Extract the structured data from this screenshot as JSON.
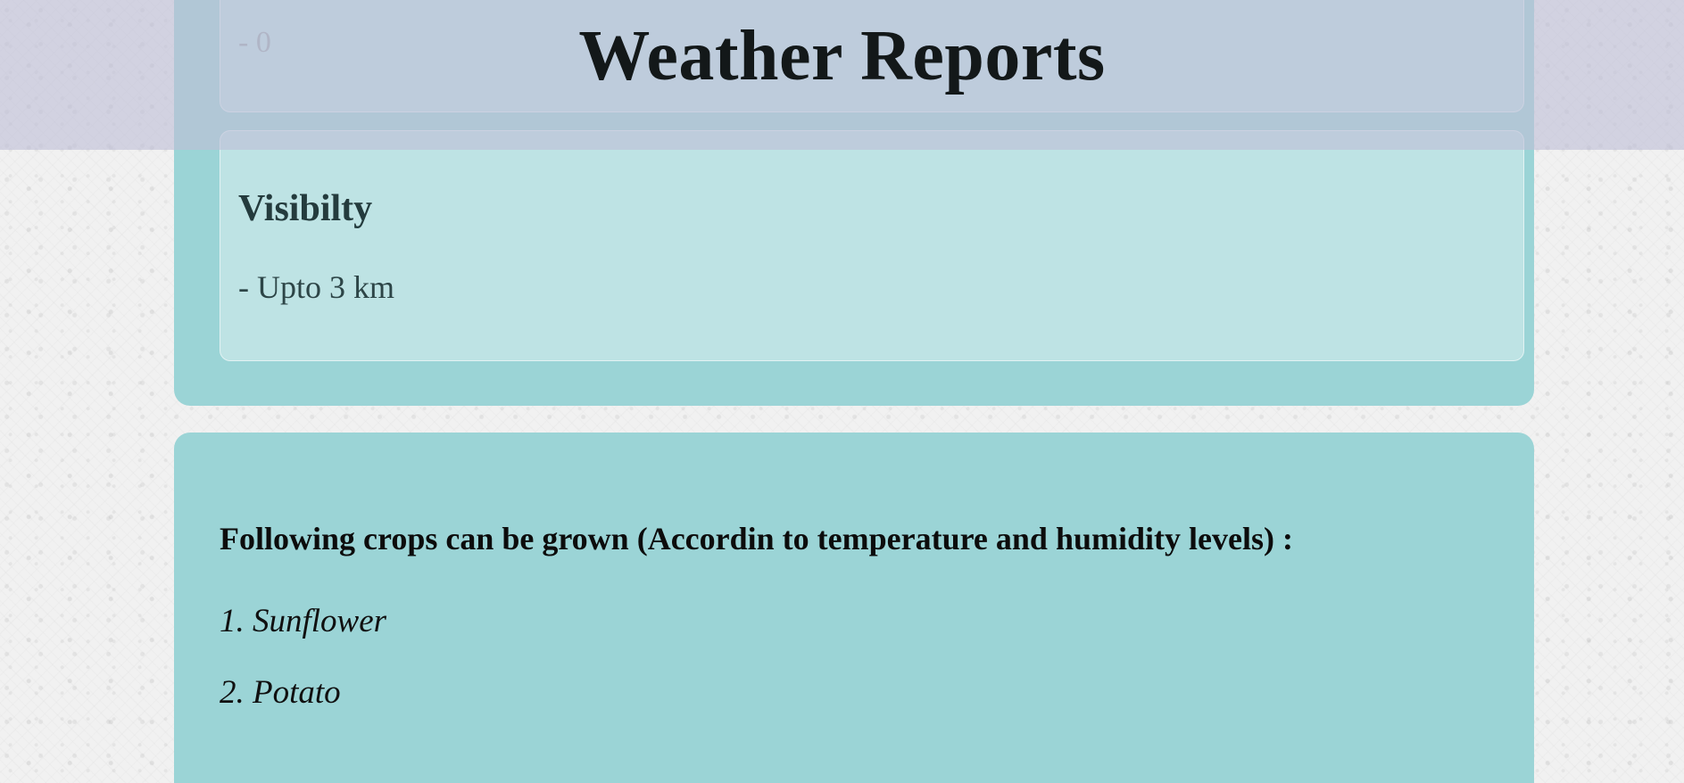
{
  "header": {
    "title": "Weather Reports"
  },
  "previous_report": {
    "value": "- 0"
  },
  "visibility": {
    "heading": "Visibilty",
    "value": "- Upto 3 km"
  },
  "crops": {
    "heading": "Following crops can be grown (Accordin to temperature and humidity levels) :",
    "items": [
      "1. Sunflower",
      "2. Potato"
    ]
  },
  "colors": {
    "card_background": "#9bd4d6",
    "header_band": "#bebed7",
    "title_text": "#131819"
  }
}
